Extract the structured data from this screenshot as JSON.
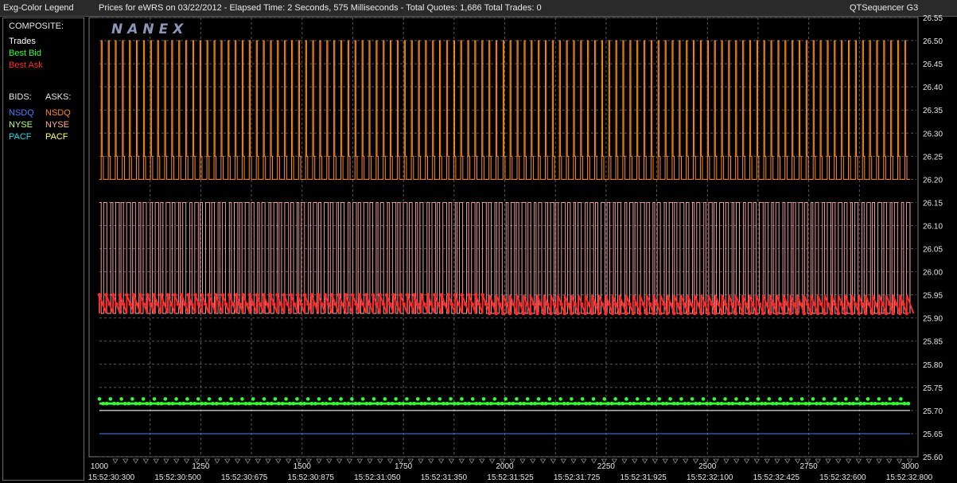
{
  "header": {
    "legend_title": "Exg-Color Legend",
    "info": "Prices for  eWRS  on  03/22/2012  -  Elapsed Time: 2 Seconds, 575 Milliseconds  -  Total Quotes: 1,686  Total Trades: 0",
    "app_name": "QTSequencer G3"
  },
  "legend": {
    "composite_label": "COMPOSITE:",
    "composite_items": [
      {
        "label": "Trades",
        "color": "#ffffff"
      },
      {
        "label": "Best Bid",
        "color": "#33ff33"
      },
      {
        "label": "Best Ask",
        "color": "#ff2a2a"
      }
    ],
    "bids_label": "BIDS:",
    "asks_label": "ASKS:",
    "exchanges": [
      {
        "bid": "NSDQ",
        "bid_color": "#4a7dff",
        "ask": "NSDQ",
        "ask_color": "#ff8c1a"
      },
      {
        "bid": "NYSE",
        "bid_color": "#b8ff80",
        "ask": "NYSE",
        "ask_color": "#ffb0a0"
      },
      {
        "bid": "PACF",
        "bid_color": "#22ddee",
        "ask": "PACF",
        "ask_color": "#ffff66"
      }
    ]
  },
  "chart_data": {
    "type": "line",
    "watermark": "NANEX",
    "xlim": [
      1000,
      3000
    ],
    "ylim": [
      25.6,
      26.55
    ],
    "x_ticks": [
      1000,
      1250,
      1500,
      1750,
      2000,
      2250,
      2500,
      2750,
      3000
    ],
    "y_ticks": [
      "26.55",
      "26.50",
      "26.45",
      "26.40",
      "26.35",
      "26.30",
      "26.25",
      "26.20",
      "26.15",
      "26.10",
      "26.05",
      "26.00",
      "25.95",
      "25.90",
      "25.85",
      "25.80",
      "25.75",
      "25.70",
      "25.65",
      "25.60"
    ],
    "time_labels": [
      "15:52:30:300",
      "15:52:30:500",
      "15:52:30:675",
      "15:52:30:875",
      "15:52:31:050",
      "15:52:31:350",
      "15:52:31:525",
      "15:52:31:725",
      "15:52:31:925",
      "15:52:32:100",
      "15:52:32:425",
      "15:52:32:600",
      "15:52:32:800"
    ],
    "series": [
      {
        "name": "NSDQ",
        "side": "ask",
        "color": "#ff8c1a",
        "low": 26.2,
        "mid": 26.25,
        "high": 26.5,
        "spikes": 115
      },
      {
        "name": "NYSE",
        "side": "ask",
        "color": "#ffaaaa",
        "low": 25.91,
        "high": 26.15
      },
      {
        "name": "Best Ask",
        "color": "#ff2a2a",
        "low": 25.91,
        "high": 25.95
      },
      {
        "name": "Best Bid",
        "color": "#33ff33",
        "low": 25.715,
        "high": 25.725
      },
      {
        "name": "NYSE",
        "side": "bid",
        "color": "#dddddd",
        "value": 25.7
      },
      {
        "name": "NSDQ",
        "side": "bid",
        "color": "#4a7dff",
        "value": 25.65
      }
    ]
  }
}
